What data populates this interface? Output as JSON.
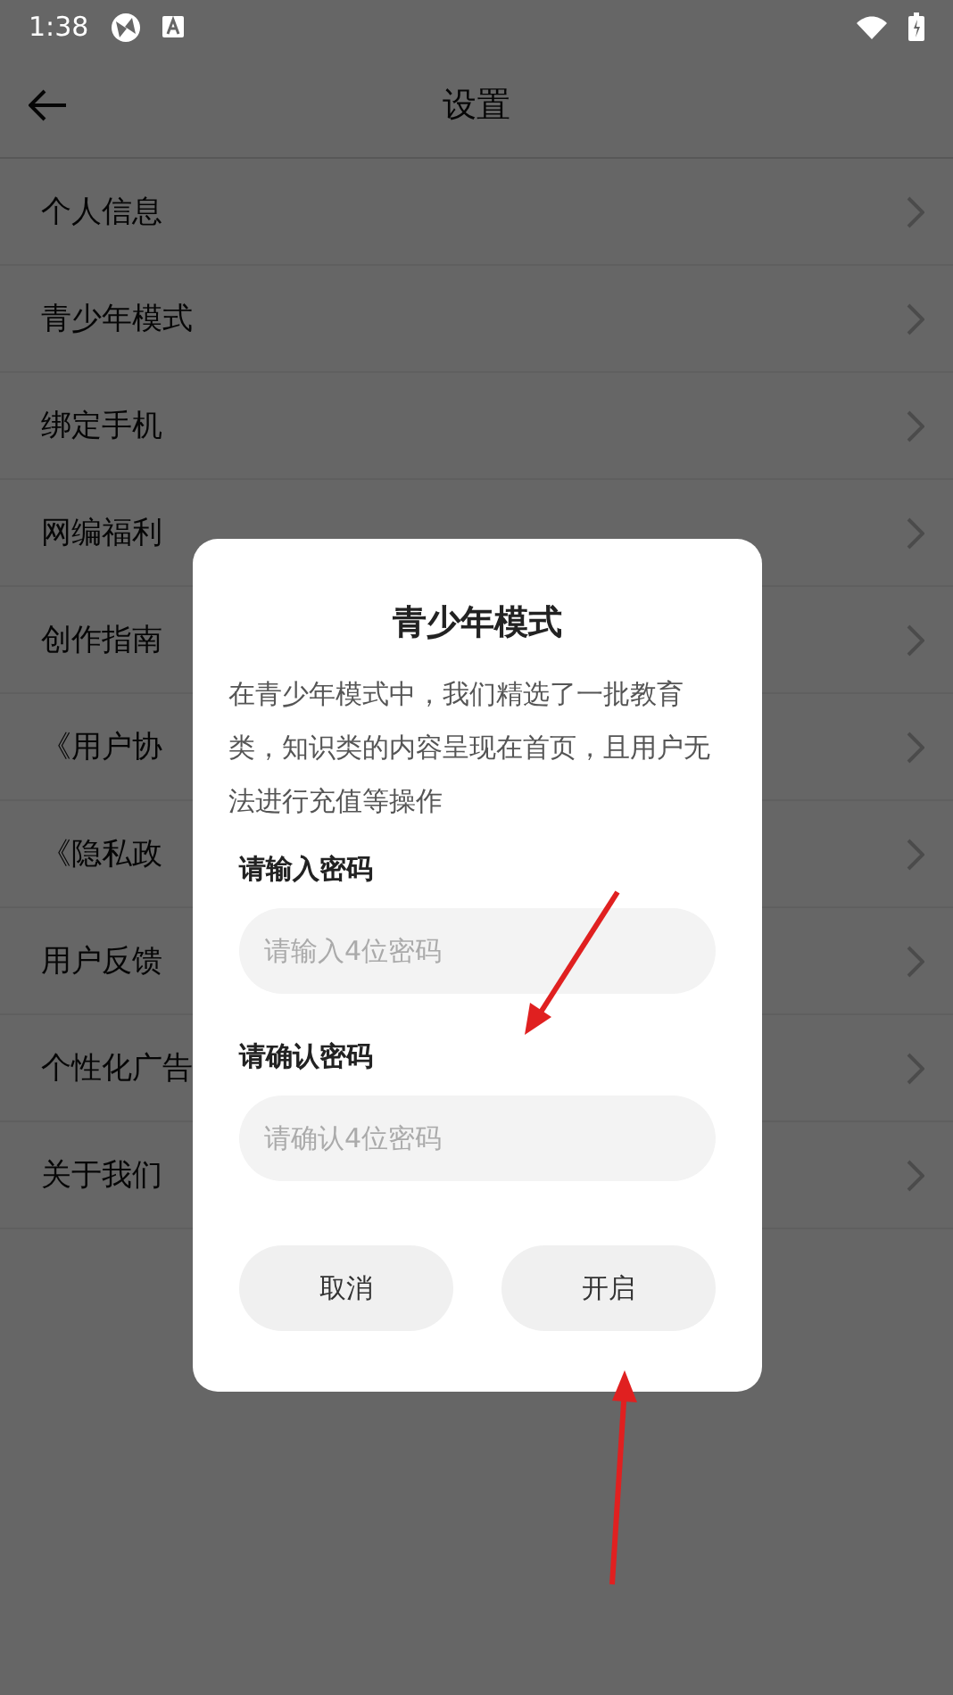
{
  "status_bar": {
    "time": "1:38"
  },
  "header": {
    "title": "设置"
  },
  "settings": [
    {
      "label": "个人信息"
    },
    {
      "label": "青少年模式"
    },
    {
      "label": "绑定手机"
    },
    {
      "label": "网编福利"
    },
    {
      "label": "创作指南"
    },
    {
      "label": "《用户协"
    },
    {
      "label": "《隐私政"
    },
    {
      "label": "用户反馈"
    },
    {
      "label": "个性化广告"
    },
    {
      "label": "关于我们"
    }
  ],
  "dialog": {
    "title": "青少年模式",
    "description": "在青少年模式中，我们精选了一批教育类，知识类的内容呈现在首页，且用户无法进行充值等操作",
    "fields": [
      {
        "label": "请输入密码",
        "placeholder": "请输入4位密码"
      },
      {
        "label": "请确认密码",
        "placeholder": "请确认4位密码"
      }
    ],
    "buttons": [
      "取消",
      "开启"
    ]
  }
}
